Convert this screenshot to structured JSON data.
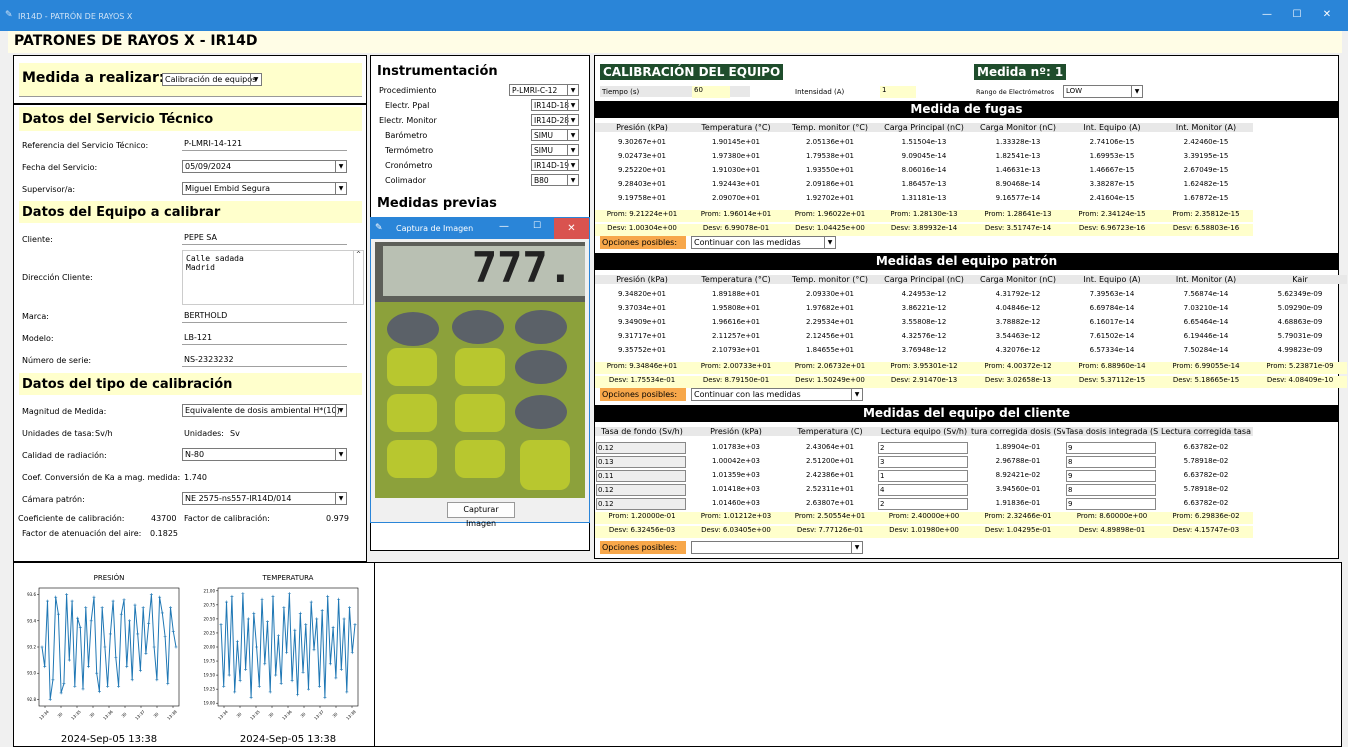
{
  "window": {
    "title": "IR14D - PATRÓN DE RAYOS X",
    "min": "—",
    "max": "☐",
    "close": "✕"
  },
  "app_title": "PATRONES DE RAYOS X - IR14D",
  "measure": {
    "label": "Medida a realizar:",
    "value": "Calibración de equipos"
  },
  "service": {
    "heading": "Datos del Servicio Técnico",
    "ref_label": "Referencia del Servicio Técnico:",
    "ref_value": "P-LMRI-14-121",
    "date_label": "Fecha del Servicio:",
    "date_value": "05/09/2024",
    "sup_label": "Supervisor/a:",
    "sup_value": "Miguel Embid Segura"
  },
  "equipment": {
    "heading": "Datos del Equipo a calibrar",
    "client_label": "Cliente:",
    "client_value": "PEPE SA",
    "addr_label": "Dirección Cliente:",
    "addr_value": "Calle sadada\nMadrid",
    "brand_label": "Marca:",
    "brand_value": "BERTHOLD",
    "model_label": "Modelo:",
    "model_value": "LB-121",
    "serial_label": "Número de serie:",
    "serial_value": "NS-2323232"
  },
  "caltype": {
    "heading": "Datos del tipo de calibración",
    "mag_label": "Magnitud de Medida:",
    "mag_value": "Equivalente de dosis ambiental H*(10)",
    "units_rate_label": "Unidades de tasa:",
    "units_rate_value": "Sv/h",
    "units_label": "Unidades:",
    "units_value": "Sv",
    "quality_label": "Calidad de radiación:",
    "quality_value": "N-80",
    "coef_label": "Coef. Conversión de Ka a mag. medida:",
    "coef_value": "1.740",
    "camera_label": "Cámara patrón:",
    "camera_value": "NE 2575-ns557-IR14D/014",
    "calcoef_label": "Coeficiente de calibración:",
    "calcoef_value": "43700",
    "calfactor_label": "Factor de calibración:",
    "calfactor_value": "0.979",
    "att_label": "Factor de atenuación del aire:",
    "att_value": "0.1825"
  },
  "instr": {
    "heading": "Instrumentación",
    "rows": [
      {
        "label": "Procedimiento",
        "value": "P-LMRI-C-12"
      },
      {
        "label": "Electr. Ppal",
        "value": "IR14D-18"
      },
      {
        "label": "Electr. Monitor",
        "value": "IR14D-28"
      },
      {
        "label": "Barómetro",
        "value": "SIMU"
      },
      {
        "label": "Termómetro",
        "value": "SIMU"
      },
      {
        "label": "Cronómetro",
        "value": "IR14D-19"
      },
      {
        "label": "Colimador",
        "value": "B80"
      }
    ],
    "prev_heading": "Medidas previas"
  },
  "capture": {
    "title": "Captura de Imagen",
    "button": "Capturar Imagen",
    "display": "777."
  },
  "calib": {
    "heading": "CALIBRACIÓN DEL EQUIPO",
    "measure_no": "Medida nº: 1",
    "time_label": "Tiempo (s)",
    "time_value": "60",
    "int_label": "Intensidad (A)",
    "int_value": "1",
    "range_label": "Rango de Electrómetros",
    "range_value": "LOW",
    "options_label": "Opciones posibles:",
    "continue": "Continuar con las medidas"
  },
  "leak": {
    "heading": "Medida de fugas",
    "headers": [
      "Presión (kPa)",
      "Temperatura (°C)",
      "Temp. monitor (°C)",
      "Carga Principal (nC)",
      "Carga Monitor (nC)",
      "Int. Equipo (A)",
      "Int. Monitor (A)"
    ],
    "rows": [
      [
        "9.30267e+01",
        "1.90145e+01",
        "2.05136e+01",
        "1.51504e-13",
        "1.33328e-13",
        "2.74106e-15",
        "2.42460e-15"
      ],
      [
        "9.02473e+01",
        "1.97380e+01",
        "1.79538e+01",
        "9.09045e-14",
        "1.82541e-13",
        "1.69953e-15",
        "3.39195e-15"
      ],
      [
        "9.25220e+01",
        "1.91030e+01",
        "1.93550e+01",
        "8.06016e-14",
        "1.46631e-13",
        "1.46667e-15",
        "2.67049e-15"
      ],
      [
        "9.28403e+01",
        "1.92443e+01",
        "2.09186e+01",
        "1.86457e-13",
        "8.90468e-14",
        "3.38287e-15",
        "1.62482e-15"
      ],
      [
        "9.19758e+01",
        "2.09070e+01",
        "1.92702e+01",
        "1.31181e-13",
        "9.16577e-14",
        "2.41604e-15",
        "1.67872e-15"
      ]
    ],
    "prom": [
      "Prom: 9.21224e+01",
      "Prom: 1.96014e+01",
      "Prom: 1.96022e+01",
      "Prom: 1.28130e-13",
      "Prom: 1.28641e-13",
      "Prom: 2.34124e-15",
      "Prom: 2.35812e-15"
    ],
    "desv": [
      "Desv: 1.00304e+00",
      "Desv: 6.99078e-01",
      "Desv: 1.04425e+00",
      "Desv: 3.89932e-14",
      "Desv: 3.51747e-14",
      "Desv: 6.96723e-16",
      "Desv: 6.58803e-16"
    ]
  },
  "standard": {
    "heading": "Medidas del equipo patrón",
    "headers": [
      "Presión (kPa)",
      "Temperatura (°C)",
      "Temp. monitor (°C)",
      "Carga Principal (nC)",
      "Carga Monitor (nC)",
      "Int. Equipo (A)",
      "Int. Monitor (A)",
      "Kair"
    ],
    "rows": [
      [
        "9.34820e+01",
        "1.89188e+01",
        "2.09330e+01",
        "4.24953e-12",
        "4.31792e-12",
        "7.39563e-14",
        "7.56874e-14",
        "5.62349e-09"
      ],
      [
        "9.37034e+01",
        "1.95808e+01",
        "1.97682e+01",
        "3.86221e-12",
        "4.04846e-12",
        "6.69784e-14",
        "7.03210e-14",
        "5.09290e-09"
      ],
      [
        "9.34909e+01",
        "1.96616e+01",
        "2.29534e+01",
        "3.55808e-12",
        "3.78882e-12",
        "6.16017e-14",
        "6.65464e-14",
        "4.68863e-09"
      ],
      [
        "9.31717e+01",
        "2.11257e+01",
        "2.12456e+01",
        "4.32576e-12",
        "3.54463e-12",
        "7.61502e-14",
        "6.19446e-14",
        "5.79031e-09"
      ],
      [
        "9.35752e+01",
        "2.10793e+01",
        "1.84655e+01",
        "3.76948e-12",
        "4.32076e-12",
        "6.57334e-14",
        "7.50284e-14",
        "4.99823e-09"
      ]
    ],
    "prom": [
      "Prom: 9.34846e+01",
      "Prom: 2.00733e+01",
      "Prom: 2.06732e+01",
      "Prom: 3.95301e-12",
      "Prom: 4.00372e-12",
      "Prom: 6.88960e-14",
      "Prom: 6.99055e-14",
      "Prom: 5.23871e-09"
    ],
    "desv": [
      "Desv: 1.75534e-01",
      "Desv: 8.79150e-01",
      "Desv: 1.50249e+00",
      "Desv: 2.91470e-13",
      "Desv: 3.02658e-13",
      "Desv: 5.37112e-15",
      "Desv: 5.18665e-15",
      "Desv: 4.08409e-10"
    ]
  },
  "client": {
    "heading": "Medidas del equipo del cliente",
    "headers": [
      "Tasa de fondo (Sv/h)",
      "Presión (kPa)",
      "Temperatura (C)",
      "Lectura equipo (Sv/h)",
      "tura corregida dosis (Sv",
      "Tasa dosis integrada (S",
      "Lectura corregida tasa"
    ],
    "rows": [
      [
        "0.12",
        "1.01783e+03",
        "2.43064e+01",
        "2",
        "1.89904e-01",
        "9",
        "6.63782e-02"
      ],
      [
        "0.13",
        "1.00042e+03",
        "2.51200e+01",
        "3",
        "2.96788e-01",
        "8",
        "5.78918e-02"
      ],
      [
        "0.11",
        "1.01359e+03",
        "2.42386e+01",
        "1",
        "8.92421e-02",
        "9",
        "6.63782e-02"
      ],
      [
        "0.12",
        "1.01418e+03",
        "2.52311e+01",
        "4",
        "3.94560e-01",
        "8",
        "5.78918e-02"
      ],
      [
        "0.12",
        "1.01460e+03",
        "2.63807e+01",
        "2",
        "1.91836e-01",
        "9",
        "6.63782e-02"
      ]
    ],
    "prom": [
      "Prom: 1.20000e-01",
      "Prom: 1.01212e+03",
      "Prom: 2.50554e+01",
      "Prom: 2.40000e+00",
      "Prom: 2.32466e-01",
      "Prom: 8.60000e+00",
      "Prom: 6.29836e-02"
    ],
    "desv": [
      "Desv: 6.32456e-03",
      "Desv: 6.03405e+00",
      "Desv: 7.77126e-01",
      "Desv: 1.01980e+00",
      "Desv: 1.04295e-01",
      "Desv: 4.89898e-01",
      "Desv: 4.15747e-03"
    ]
  },
  "chart_data": [
    {
      "type": "line",
      "title": "PRESIÓN",
      "xlabel": "2024-Sep-05 13:38",
      "x_ticks": [
        "13:34",
        "30",
        "13:35",
        "30",
        "13:36",
        "30",
        "13:37",
        "30",
        "13:38"
      ],
      "y_ticks": [
        "93.6",
        "93.4",
        "93.2",
        "93.0",
        "92.8"
      ],
      "ylim": [
        92.75,
        93.65
      ],
      "color": "#1f77b4",
      "values": [
        93.2,
        93.05,
        93.55,
        92.8,
        92.95,
        93.58,
        93.45,
        92.85,
        92.92,
        93.6,
        93.1,
        93.55,
        92.9,
        93.42,
        93.35,
        92.88,
        93.5,
        93.05,
        93.4,
        93.58,
        93.0,
        92.86,
        93.5,
        93.2,
        92.9,
        93.3,
        93.55,
        93.12,
        92.9,
        93.45,
        93.56,
        93.05,
        93.4,
        92.95,
        93.52,
        93.3,
        93.02,
        93.5,
        93.15,
        93.38,
        93.6,
        93.2,
        92.95,
        93.58,
        93.46,
        93.28,
        92.92,
        93.5,
        93.32,
        93.2
      ]
    },
    {
      "type": "line",
      "title": "TEMPERATURA",
      "xlabel": "2024-Sep-05 13:38",
      "x_ticks": [
        "13:34",
        "30",
        "13:35",
        "30",
        "13:36",
        "30",
        "13:37",
        "30",
        "13:38"
      ],
      "y_ticks": [
        "21.00",
        "20.75",
        "20.50",
        "20.25",
        "20.00",
        "19.75",
        "19.50",
        "19.25",
        "19.00"
      ],
      "ylim": [
        18.95,
        21.05
      ],
      "color": "#1f77b4",
      "values": [
        20.4,
        19.3,
        20.8,
        19.5,
        20.9,
        19.2,
        20.1,
        19.4,
        20.95,
        19.6,
        20.5,
        19.1,
        20.6,
        20.0,
        19.3,
        20.85,
        19.7,
        20.45,
        19.2,
        20.9,
        19.5,
        20.2,
        19.35,
        20.7,
        19.9,
        20.95,
        19.4,
        20.3,
        19.15,
        20.6,
        19.55,
        20.4,
        19.25,
        20.8,
        19.95,
        20.5,
        19.3,
        20.65,
        19.1,
        20.9,
        19.7,
        20.35,
        19.45,
        20.85,
        19.6,
        20.5,
        19.2,
        20.7,
        19.9,
        20.4
      ]
    }
  ]
}
